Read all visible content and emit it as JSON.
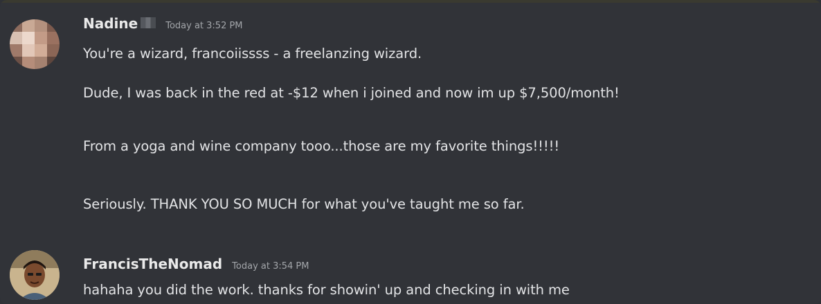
{
  "messages": [
    {
      "username": "Nadine",
      "timestamp": "Today at 3:52 PM",
      "lines": [
        "You're a wizard, francoiissss - a freelanzing wizard.",
        "Dude, I was back in the red at -$12 when i joined and now im up $7,500/month!",
        "From a yoga and wine company tooo...those are my favorite things!!!!!",
        "Seriously. THANK YOU SO MUCH for what you've taught me so far."
      ]
    },
    {
      "username": "FrancisTheNomad",
      "timestamp": "Today at 3:54 PM",
      "lines": [
        "hahaha you did the work. thanks for showin' up and checking in with me"
      ]
    }
  ],
  "colors": {
    "background": "#313338",
    "username": "#eaeaea",
    "timestamp": "#a3a6aa",
    "message_text": "#e3e4e6"
  }
}
